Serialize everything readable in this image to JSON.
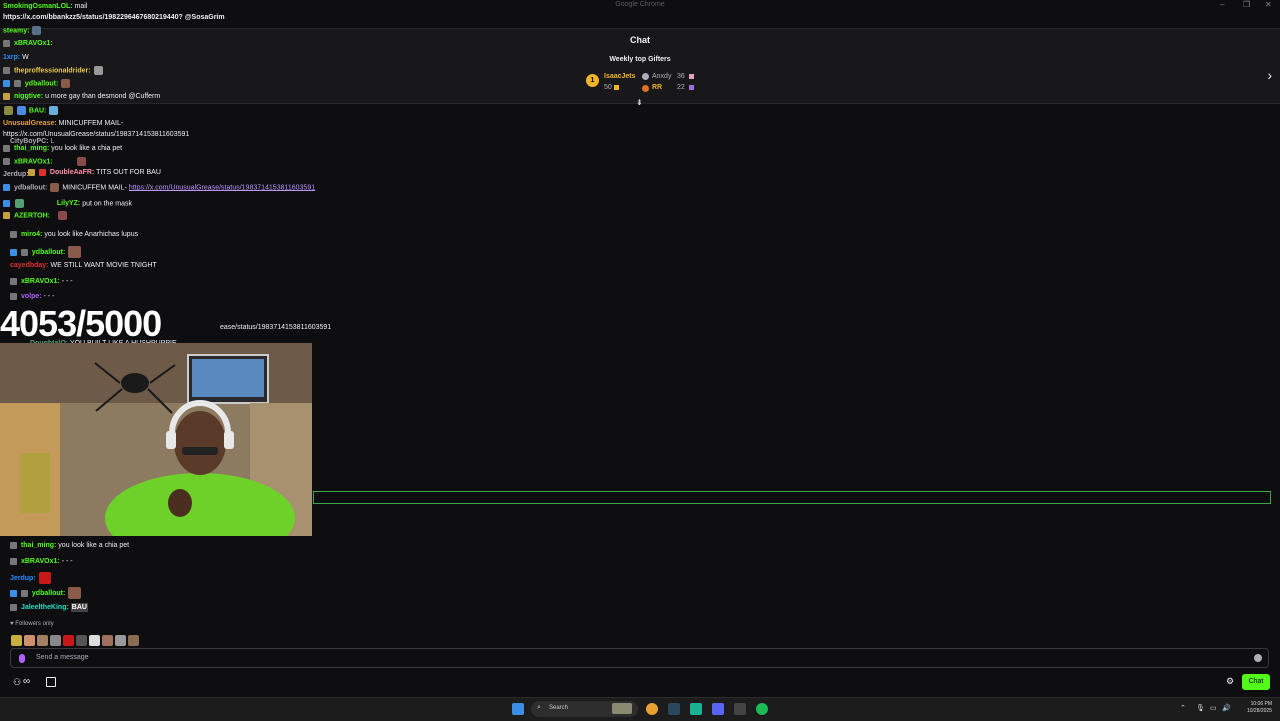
{
  "window": {
    "title": "Google Chrome"
  },
  "overlay_top": {
    "user": "SmokingOsmanLOL:",
    "text": "mail",
    "url_line": "https://x.com/bbankzz5/status/1982296467680219440? @SosaGrim"
  },
  "header": {
    "title": "Chat",
    "gifters_title": "Weekly top Gifters",
    "gifters": [
      {
        "rank": "1",
        "name": "IsaacJets",
        "count": "50"
      },
      {
        "name": "Anxdy",
        "count": "36"
      },
      {
        "name": "RR",
        "count": "22"
      }
    ]
  },
  "chat_lines": {
    "l1_user": "steamy:",
    "l2_user": "xBRAVOx1:",
    "l3_user": "1xrp:",
    "l3_text": "W",
    "l4_user": "theproffessionaldrider:",
    "l5_user": "ydballout:",
    "l6_user": "niggtive:",
    "l6_text": "u more gay than desmond @Cufferm",
    "l7_user": "BAU:",
    "l8_user": "UnusualGrease:",
    "l8_text": "MINICUFFEM MAIL-",
    "l8_url": "https://x.com/UnusualGrease/status/1983714153811603591",
    "l9_user": "CityBoyPC:",
    "l9_text": "L",
    "l10_user": "thai_ming:",
    "l10_text": "you look like a chia pet",
    "l11_user": "xBRAVOx1:",
    "l12_user": "Jerdup:",
    "l13_user": "DoubleAaFR:",
    "l13_text": "TITS OUT FOR BAU",
    "l14_user": "ydballout:",
    "l14_text": "MINICUFFEM MAIL-",
    "l14_url": "https://x.com/UnusualGrease/status/1983714153811603591",
    "l15_user": "LilyYZ:",
    "l15_text": "put on the mask",
    "l16_user": "AZERTOH:",
    "l17_user": "miro4:",
    "l17_text": "you look like Anarhichas lupus",
    "l18_user": "ydballout:",
    "l19_user": "cayedbday:",
    "l19_text": "WE STILL WANT MOVIE TNIGHT",
    "l20_user": "xBRAVOx1:",
    "l20_text": "- - -",
    "l21_user": "volpe:",
    "l21_text": "- - -",
    "l22_url_partial": "ease/status/1983714153811603591",
    "l23_user": "DoughtalQ:",
    "l23_text": "YOU BUILT LIKE A HUSHPUPPIE"
  },
  "counter": "4053/5000",
  "recent": {
    "r1_user": "thai_ming:",
    "r1_text": "you look like a chia pet",
    "r2_user": "xBRAVOx1:",
    "r2_text": "- - -",
    "r3_user": "Jerdup:",
    "r4_user": "ydballout:",
    "r5_user": "JaleeltheKing:",
    "r5_emote_text": "BAU"
  },
  "followers_only": "Followers only",
  "input": {
    "placeholder": "Send a message"
  },
  "chat_button": "Chat",
  "taskbar": {
    "search": "Search",
    "time": "10:06 PM",
    "date": "10/28/2025"
  },
  "colors": {
    "accent": "#53fc18",
    "link": "#bf94ff",
    "bg": "#0e0e10",
    "panel": "#18181b"
  }
}
